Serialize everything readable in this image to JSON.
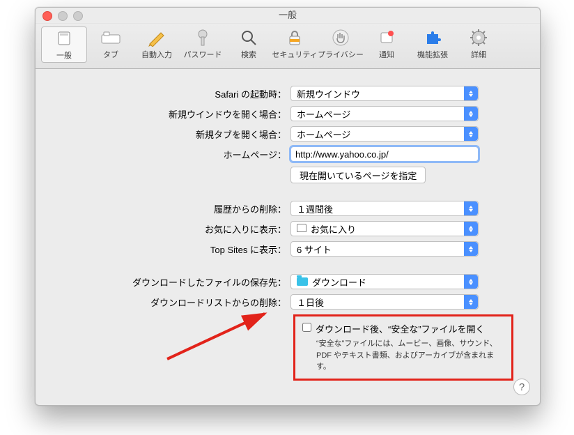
{
  "window": {
    "title": "一般"
  },
  "toolbar": {
    "general": "一般",
    "tabs": "タブ",
    "autofill": "自動入力",
    "passwords": "パスワード",
    "search": "検索",
    "security": "セキュリティ",
    "privacy": "プライバシー",
    "notifications": "通知",
    "extensions": "機能拡張",
    "advanced": "詳細"
  },
  "labels": {
    "launch": "Safari の起動時：",
    "newwin": "新規ウインドウを開く場合：",
    "newtab": "新規タブを開く場合：",
    "homepage": "ホームページ：",
    "history": "履歴からの削除：",
    "favorites": "お気に入りに表示：",
    "topsites": "Top Sites に表示：",
    "dlloc": "ダウンロードしたファイルの保存先：",
    "dlremove": "ダウンロードリストからの削除："
  },
  "values": {
    "launch": "新規ウインドウ",
    "newwin": "ホームページ",
    "newtab": "ホームページ",
    "homepage": "http://www.yahoo.co.jp/",
    "setcurrent": "現在開いているページを指定",
    "history": "１週間後",
    "favorites": "お気に入り",
    "topsites": "6 サイト",
    "dlloc": "ダウンロード",
    "dlremove": "１日後"
  },
  "safe": {
    "cb": "ダウンロード後、“安全な”ファイルを開く",
    "desc": "“安全な”ファイルには、ムービー、画像、サウンド、PDF やテキスト書類、およびアーカイブが含まれます。"
  },
  "help": "?"
}
